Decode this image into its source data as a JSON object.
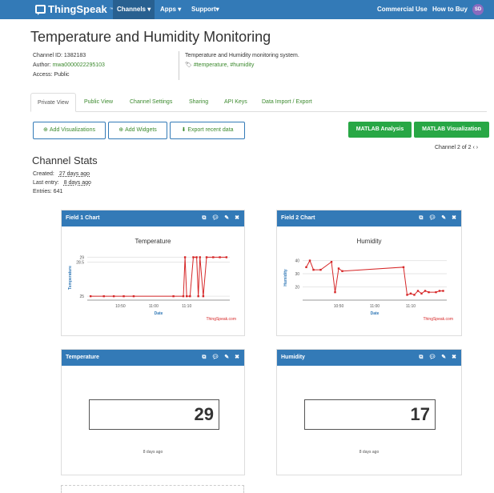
{
  "nav": {
    "brand": "ThingSpeak",
    "brand_tm": "™",
    "items": [
      "Channels ▾",
      "Apps ▾",
      "Support▾"
    ],
    "right_items": [
      "Commercial Use",
      "How to Buy"
    ],
    "avatar": "SD"
  },
  "page_title": "Temperature and Humidity Monitoring",
  "meta": {
    "channel_id": "Channel ID: 1382183",
    "author_label": "Author: ",
    "author": "mwa0000022295103",
    "access": "Access: Public",
    "description": "Temperature and Humidity monitoring system.",
    "tags": "#temperature, #humidity"
  },
  "tabs": [
    "Private View",
    "Public View",
    "Channel Settings",
    "Sharing",
    "API Keys",
    "Data Import / Export"
  ],
  "buttons": {
    "add_visualizations": "Add Visualizations",
    "add_widgets": "Add Widgets",
    "export": "Export recent data",
    "matlab_analysis": "MATLAB Analysis",
    "matlab_visualization": "MATLAB Visualization"
  },
  "channel_of": "Channel 2 of 2",
  "stats": {
    "title": "Channel Stats",
    "created_label": "Created:",
    "created": "27 days ago",
    "last_entry_label": "Last entry:",
    "last_entry": "8 days ago",
    "entries": "Entries: 641"
  },
  "cards": {
    "field1": "Field 1 Chart",
    "field2": "Field 2 Chart",
    "temperature": "Temperature",
    "humidity": "Humidity",
    "temp_value": "29",
    "hum_value": "17",
    "temp_ago": "8 days ago",
    "hum_ago": "8 days ago"
  },
  "icon_colors": {
    "header": "#337ab7",
    "line": "#d62728",
    "green": "#28a745"
  },
  "chart_data": [
    {
      "type": "line",
      "title": "Temperature",
      "xlabel": "Date",
      "ylabel": "Temperature",
      "credit": "ThingSpeak.com",
      "x_ticks": [
        "10:50",
        "11:00",
        "11:10"
      ],
      "y_ticks": [
        25,
        28.5,
        29
      ],
      "series": [
        {
          "values": [
            [
              "10:41",
              25
            ],
            [
              "10:45",
              25
            ],
            [
              "10:48",
              25
            ],
            [
              "10:51",
              25
            ],
            [
              "10:54",
              25
            ],
            [
              "11:06",
              25
            ],
            [
              "11:09",
              25
            ],
            [
              "11:09.5",
              29
            ],
            [
              "11:10",
              25
            ],
            [
              "11:11",
              25
            ],
            [
              "11:12",
              29
            ],
            [
              "11:13",
              29
            ],
            [
              "11:13.5",
              25
            ],
            [
              "11:14",
              29
            ],
            [
              "11:15",
              25
            ],
            [
              "11:16",
              29
            ],
            [
              "11:18",
              29
            ],
            [
              "11:20",
              29
            ],
            [
              "11:22",
              29
            ]
          ]
        }
      ]
    },
    {
      "type": "line",
      "title": "Humidity",
      "xlabel": "Date",
      "ylabel": "Humidity",
      "credit": "ThingSpeak.com",
      "x_ticks": [
        "10:50",
        "11:00",
        "11:10"
      ],
      "y_ticks": [
        20,
        30,
        40
      ],
      "series": [
        {
          "values": [
            [
              "10:41",
              35
            ],
            [
              "10:42",
              40
            ],
            [
              "10:43",
              33
            ],
            [
              "10:45",
              33
            ],
            [
              "10:48",
              39
            ],
            [
              "10:49",
              16
            ],
            [
              "10:50",
              34
            ],
            [
              "10:51",
              32
            ],
            [
              "11:08",
              35
            ],
            [
              "11:09",
              14
            ],
            [
              "11:10",
              15
            ],
            [
              "11:11",
              14
            ],
            [
              "11:12",
              17
            ],
            [
              "11:13",
              15
            ],
            [
              "11:14",
              17
            ],
            [
              "11:15",
              16
            ],
            [
              "11:17",
              16
            ],
            [
              "11:18",
              17
            ],
            [
              "11:19",
              17
            ]
          ]
        }
      ]
    }
  ]
}
